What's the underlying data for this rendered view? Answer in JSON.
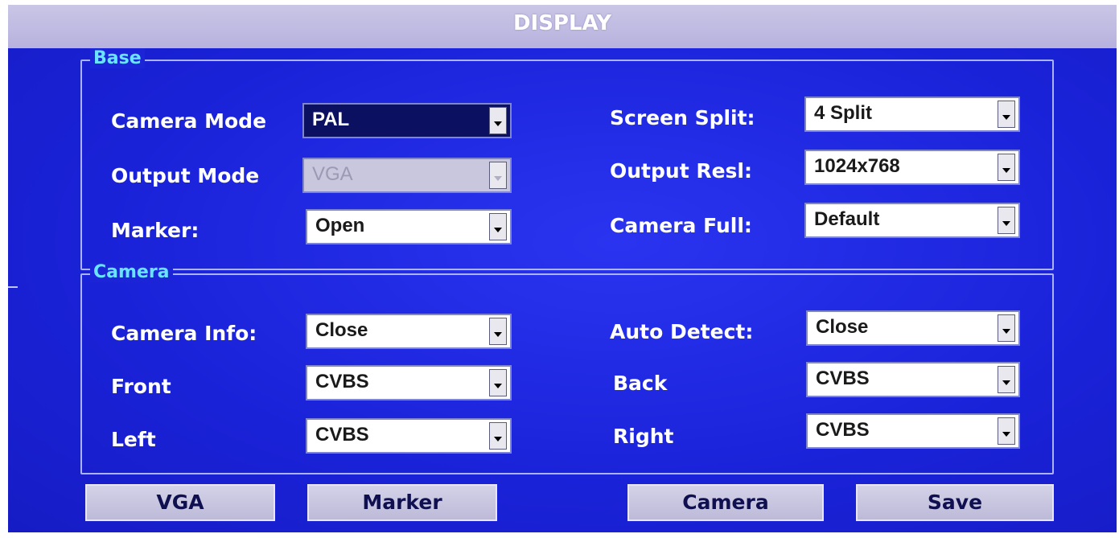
{
  "window": {
    "title": "DISPLAY"
  },
  "base": {
    "legend": "Base",
    "camera_mode": {
      "label": "Camera Mode",
      "value": "PAL"
    },
    "output_mode": {
      "label": "Output Mode",
      "value": "VGA"
    },
    "marker": {
      "label": "Marker:",
      "value": "Open"
    },
    "screen_split": {
      "label": "Screen Split:",
      "value": "4 Split"
    },
    "output_resl": {
      "label": "Output Resl:",
      "value": "1024x768"
    },
    "camera_full": {
      "label": "Camera Full:",
      "value": "Default"
    }
  },
  "camera": {
    "legend": "Camera",
    "camera_info": {
      "label": "Camera Info:",
      "value": "Close"
    },
    "front": {
      "label": "Front",
      "value": "CVBS"
    },
    "left": {
      "label": "Left",
      "value": "CVBS"
    },
    "auto_detect": {
      "label": "Auto Detect:",
      "value": "Close"
    },
    "back": {
      "label": "Back",
      "value": "CVBS"
    },
    "right": {
      "label": "Right",
      "value": "CVBS"
    }
  },
  "buttons": {
    "vga": "VGA",
    "marker": "Marker",
    "camera": "Camera",
    "save": "Save"
  },
  "colors": {
    "background": "#1a1fd6",
    "titlebar": "#c0bce2",
    "legend": "#68e4ff",
    "selected_field": "#0b1060"
  },
  "icons": {
    "dropdown": "chevron-down-icon"
  }
}
